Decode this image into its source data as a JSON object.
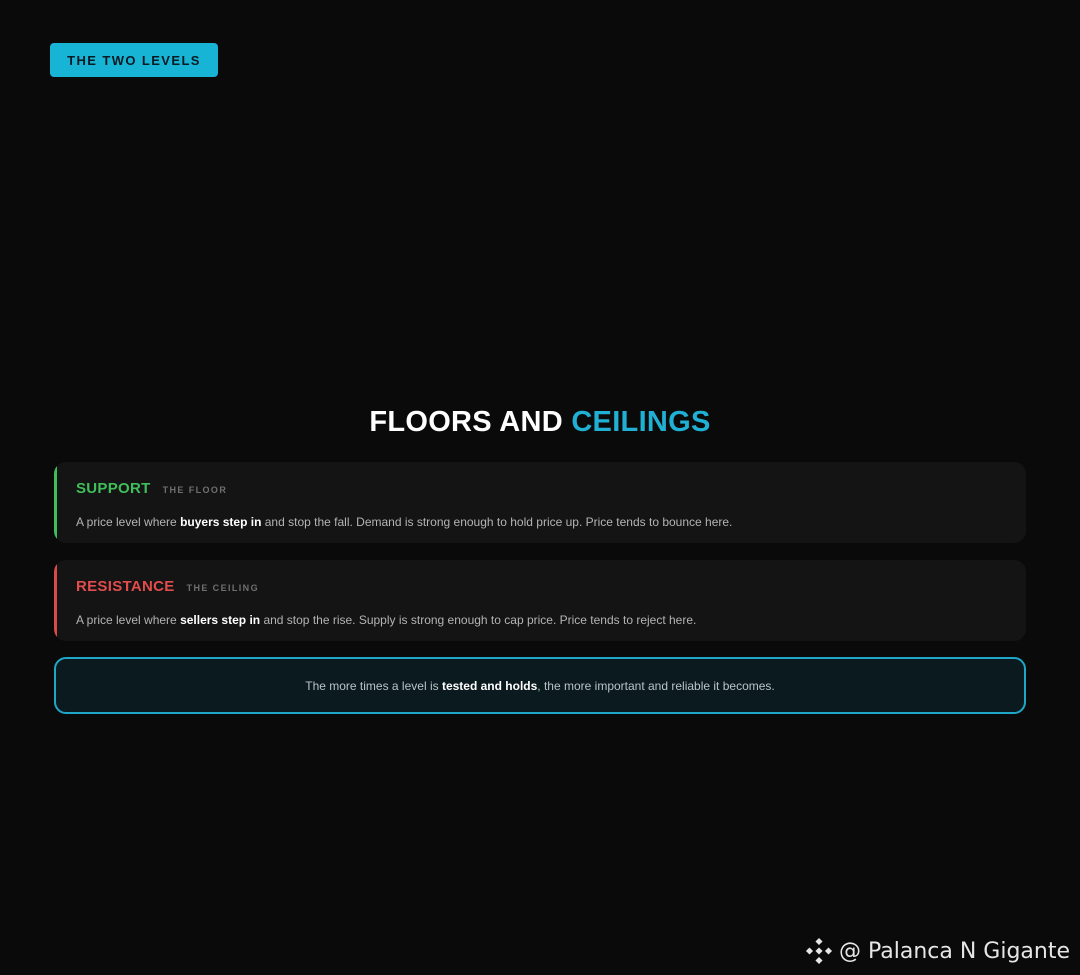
{
  "badge": {
    "label": "THE TWO LEVELS"
  },
  "title": {
    "part1": "FLOORS AND ",
    "part2": "CEILINGS"
  },
  "support": {
    "name": "SUPPORT",
    "sub": "THE FLOOR",
    "text_before": "A price level where ",
    "text_bold": "buyers step in",
    "text_after": " and stop the fall. Demand is strong enough to hold price up. Price tends to bounce here."
  },
  "resistance": {
    "name": "RESISTANCE",
    "sub": "THE CEILING",
    "text_before": "A price level where ",
    "text_bold": "sellers step in",
    "text_after": " and stop the rise. Supply is strong enough to cap price. Price tends to reject here."
  },
  "note": {
    "text_before": "The more times a level is ",
    "text_bold": "tested and holds",
    "text_after": ", the more important and reliable it becomes."
  },
  "watermark": {
    "text": "@ Palanca N Gigante",
    "icon": "binance-logo-icon"
  },
  "colors": {
    "accent": "#1fb0d3",
    "support": "#3fbf5b",
    "resistance": "#e24c4c",
    "background": "#0a0a0a"
  }
}
